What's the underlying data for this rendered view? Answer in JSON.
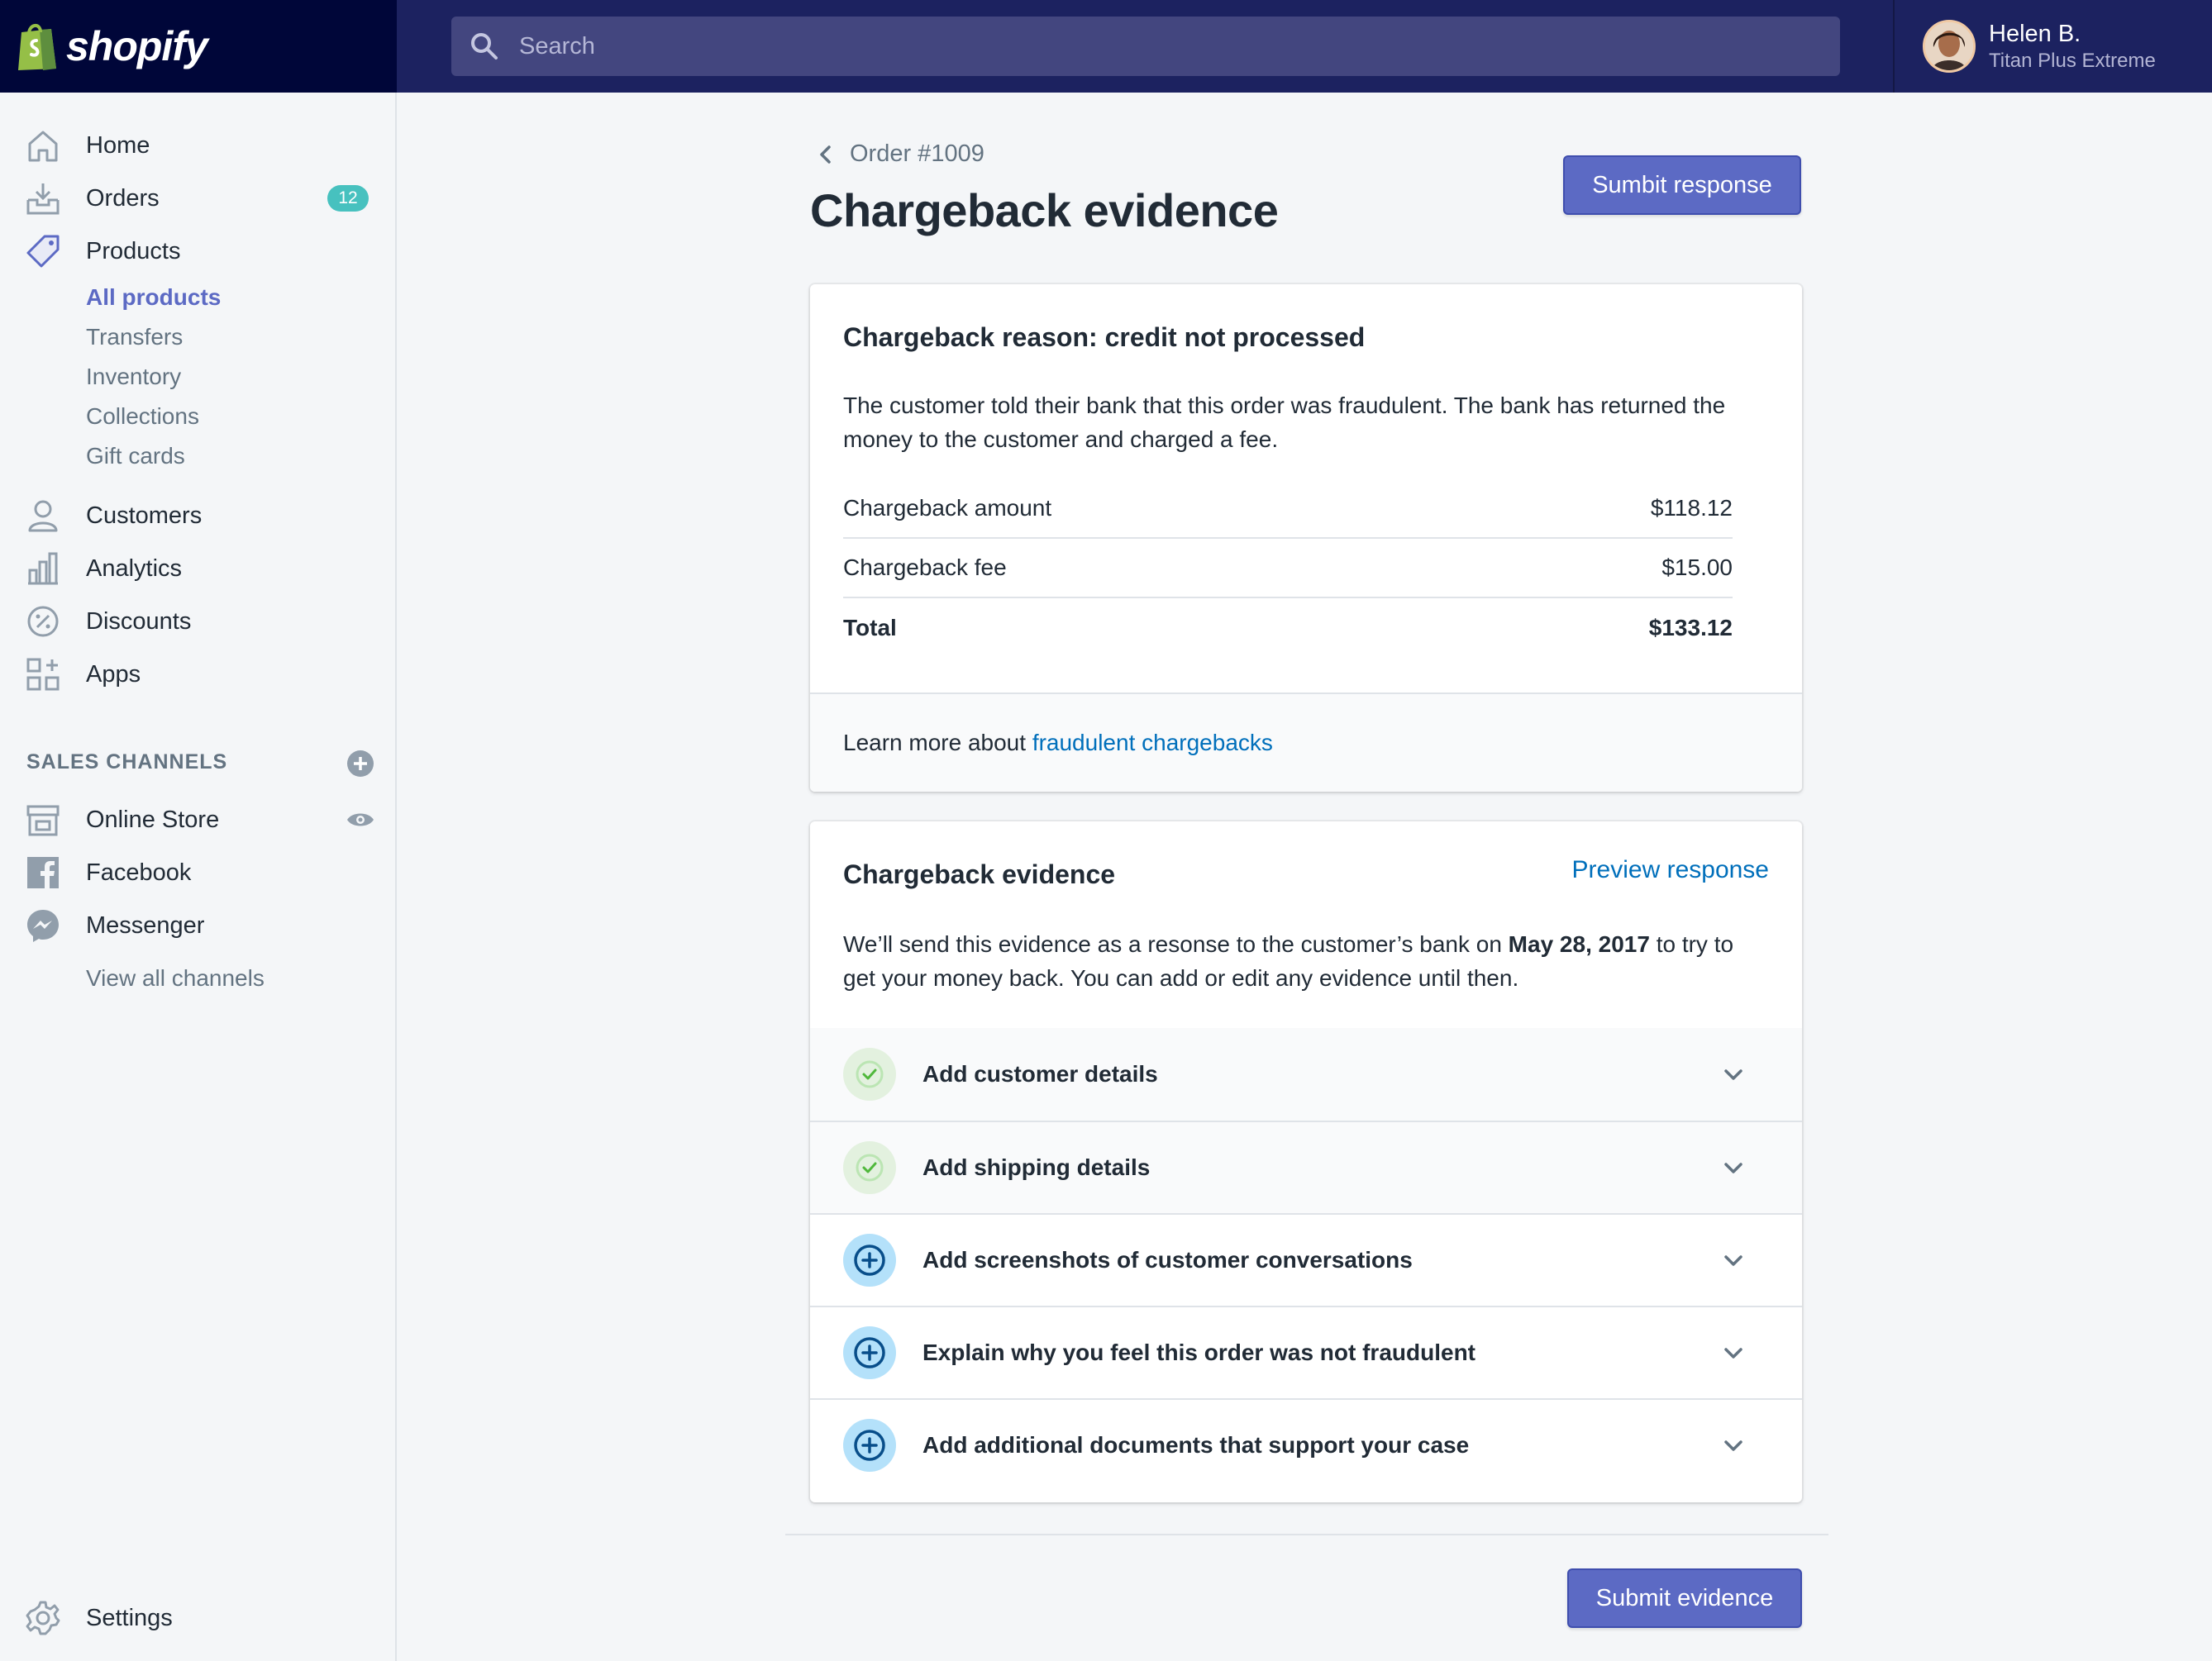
{
  "brand": {
    "name": "shopify"
  },
  "search": {
    "placeholder": "Search"
  },
  "user": {
    "name": "Helen B.",
    "store": "Titan Plus Extreme"
  },
  "sidebar": {
    "items": [
      {
        "label": "Home",
        "icon": "home-icon"
      },
      {
        "label": "Orders",
        "icon": "orders-icon",
        "badge": "12"
      },
      {
        "label": "Products",
        "icon": "tag-icon"
      },
      {
        "label": "Customers",
        "icon": "person-icon"
      },
      {
        "label": "Analytics",
        "icon": "bar-chart-icon"
      },
      {
        "label": "Discounts",
        "icon": "discount-icon"
      },
      {
        "label": "Apps",
        "icon": "apps-icon"
      }
    ],
    "product_subitems": [
      "All products",
      "Transfers",
      "Inventory",
      "Collections",
      "Gift cards"
    ],
    "sales_channels_heading": "SALES CHANNELS",
    "channels": [
      {
        "label": "Online Store",
        "icon": "store-icon"
      },
      {
        "label": "Facebook",
        "icon": "facebook-icon"
      },
      {
        "label": "Messenger",
        "icon": "messenger-icon"
      }
    ],
    "view_all_channels": "View all channels",
    "settings": "Settings"
  },
  "page": {
    "breadcrumb": "Order #1009",
    "title": "Chargeback evidence",
    "submit_response_label": "Sumbit response"
  },
  "reason_card": {
    "title": "Chargeback reason: credit not processed",
    "description": "The customer told their bank that this order was fraudulent. The bank has returned the money to the customer and charged a fee.",
    "rows": [
      {
        "label": "Chargeback amount",
        "value": "$118.12"
      },
      {
        "label": "Chargeback fee",
        "value": "$15.00"
      },
      {
        "label": "Total",
        "value": "$133.12"
      }
    ],
    "footer_text": "Learn more about ",
    "footer_link": "fraudulent chargebacks"
  },
  "evidence_card": {
    "title": "Chargeback evidence",
    "preview_link": "Preview response",
    "text_before": "We’ll send this evidence as a resonse to the customer’s bank on ",
    "date": "May 28, 2017",
    "text_after": " to try to get your money back. You can add or edit any evidence until then.",
    "items": [
      {
        "label": "Add customer details",
        "status": "complete"
      },
      {
        "label": "Add shipping details",
        "status": "complete"
      },
      {
        "label": "Add screenshots of customer conversations",
        "status": "add"
      },
      {
        "label": "Explain why you feel this order was not fraudulent",
        "status": "add"
      },
      {
        "label": "Add additional documents that support your case",
        "status": "add"
      }
    ]
  },
  "submit_evidence_label": "Submit evidence",
  "colors": {
    "topbar": "#1c2260",
    "logo_bg": "#000639",
    "accent": "#5c6ac4",
    "link": "#006fbb",
    "badge": "#47c1bf",
    "complete": "#e3f1df",
    "add": "#b4e1fa"
  }
}
